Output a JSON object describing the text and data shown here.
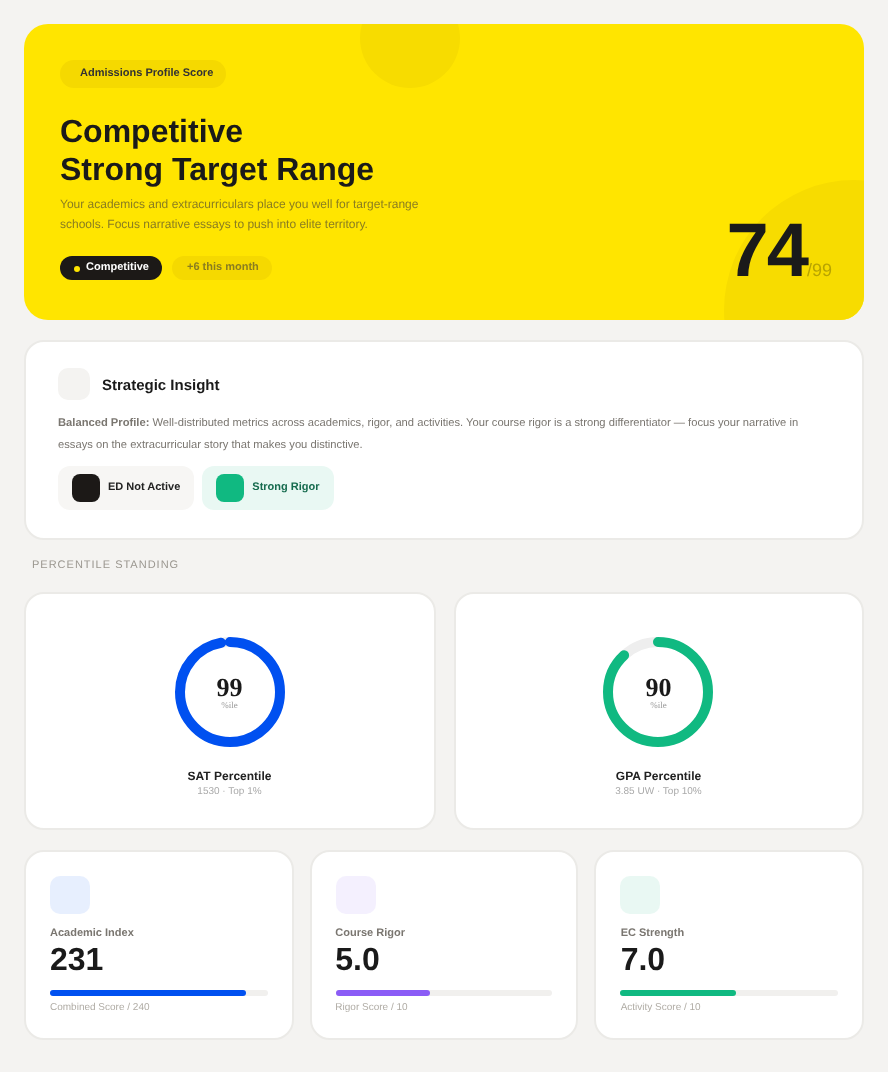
{
  "hero": {
    "badge": "Admissions Profile Score",
    "title_lines": [
      "Competitive",
      "Strong Target Range"
    ],
    "description": "Your academics and extracurriculars place you well for target-range schools. Focus narrative essays to push into elite territory.",
    "tier_chip": "Competitive",
    "trend_chip": "+6 this month",
    "score": "74",
    "score_max": "/99"
  },
  "insight": {
    "title": "Strategic Insight",
    "text": "**Balanced Profile:** Well-distributed metrics across academics, rigor, and activities. Your course rigor is a strong differentiator — focus your narrative in essays on the extracurricular story that makes you distinctive.",
    "tags": [
      {
        "label": "ED Not Active",
        "color": "#1c1917"
      },
      {
        "label": "Strong Rigor",
        "color": "#10b981"
      }
    ]
  },
  "section_label": "PERCENTILE STANDING",
  "percentiles": [
    {
      "value": "99",
      "unit": "%ile",
      "name": "SAT Percentile",
      "detail": "1530 · Top 1%",
      "level": 0.97,
      "color": "#0050f0"
    },
    {
      "value": "90",
      "unit": "%ile",
      "name": "GPA Percentile",
      "detail": "3.85 UW · Top 10%",
      "level": 0.88,
      "color": "#10b981"
    }
  ],
  "metrics": [
    {
      "label": "Academic Index",
      "value": "231",
      "caption": "Combined Score / 240",
      "level": 0.9,
      "color": "#0050f0"
    },
    {
      "label": "Course Rigor",
      "value": "5.0",
      "caption": "Rigor Score / 10",
      "level": 0.44,
      "color": "#8b5cf6"
    },
    {
      "label": "EC Strength",
      "value": "7.0",
      "caption": "Activity Score / 10",
      "level": 0.53,
      "color": "#10b981"
    }
  ]
}
